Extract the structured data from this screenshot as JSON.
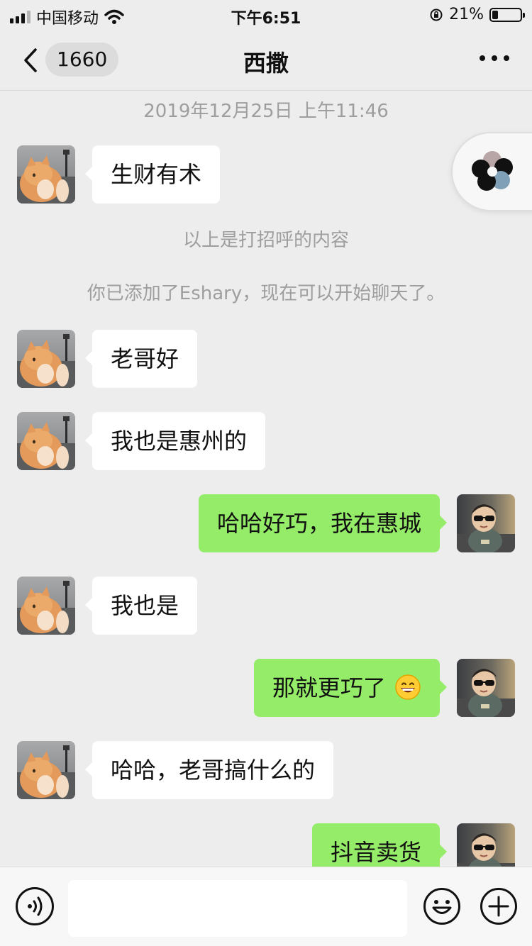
{
  "status_bar": {
    "carrier": "中国移动",
    "time": "下午6:51",
    "battery_percent": "21%",
    "battery_level": 0.21,
    "icons": [
      "signal-icon",
      "wifi-icon",
      "rotation-lock-icon",
      "battery-icon"
    ]
  },
  "nav": {
    "back_icon": "chevron-left-icon",
    "unread_count": "1660",
    "title": "西撒",
    "more_icon": "more-icon"
  },
  "chat": {
    "timestamp": "2019年12月25日 上午11:46",
    "system_notice_1": "以上是打招呼的内容",
    "system_notice_2": "你已添加了Eshary，现在可以开始聊天了。",
    "messages": [
      {
        "side": "in",
        "text": "生财有术"
      },
      {
        "side": "in",
        "text": "老哥好"
      },
      {
        "side": "in",
        "text": "我也是惠州的"
      },
      {
        "side": "out",
        "text": "哈哈好巧，我在惠城"
      },
      {
        "side": "in",
        "text": "我也是"
      },
      {
        "side": "out",
        "text": "那就更巧了",
        "emoji": "grinning-face-emoji"
      },
      {
        "side": "in",
        "text": "哈哈，老哥搞什么的"
      },
      {
        "side": "out",
        "text": "抖音卖货"
      }
    ]
  },
  "floating_button": {
    "icon": "floating-window-icon"
  },
  "input_bar": {
    "voice_icon": "voice-icon",
    "input_value": "",
    "emoji_icon": "emoji-icon",
    "plus_icon": "plus-icon"
  },
  "colors": {
    "background": "#ededed",
    "incoming_bubble": "#ffffff",
    "outgoing_bubble": "#95ec69",
    "system_text": "#9e9e9e"
  }
}
